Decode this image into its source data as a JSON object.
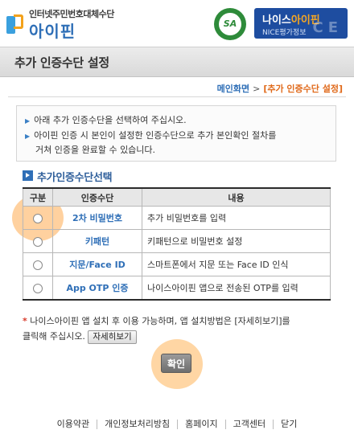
{
  "header": {
    "logo_subtitle": "인터넷주민번호대체수단",
    "logo_name": "아이핀",
    "sa_badge": "SA",
    "nice_badge": {
      "name_prefix": "나이스",
      "name_accent": "아이핀",
      "sub": "NICE평가정보",
      "mark": "CE"
    }
  },
  "page_title": "추가 인증수단 설정",
  "breadcrumb": {
    "home": "메인화면",
    "separator": ">",
    "current": "[추가 인증수단 설정]"
  },
  "info": {
    "line1": "아래 추가 인증수단을 선택하여 주십시오.",
    "line2": "아이핀 인증 시 본인이 설정한 인증수단으로 추가 본인확인 절차를",
    "line3": "거쳐 인증을 완료할 수 있습니다."
  },
  "section_title": "추가인증수단선택",
  "table": {
    "headers": [
      "구분",
      "인증수단",
      "내용"
    ],
    "rows": [
      {
        "method": "2차 비밀번호",
        "desc": "추가 비밀번호를 입력"
      },
      {
        "method": "키패턴",
        "desc": "키패턴으로 비밀번호 설정"
      },
      {
        "method": "지문/Face ID",
        "desc": "스마트폰에서 지문 또는 Face ID 인식"
      },
      {
        "method": "App OTP 인증",
        "desc": "나이스아이핀 앱으로 전송된 OTP를 입력"
      }
    ]
  },
  "note": {
    "star": "*",
    "text1": "나이스아이핀 앱 설치 후 이용 가능하며, 앱 설치방법은 [자세히보기]를",
    "text2": "클릭해 주십시오.",
    "detail_button": "자세히보기"
  },
  "confirm_button": "확인",
  "footer": [
    "이용약관",
    "개인정보처리방침",
    "홈페이지",
    "고객센터",
    "닫기"
  ]
}
